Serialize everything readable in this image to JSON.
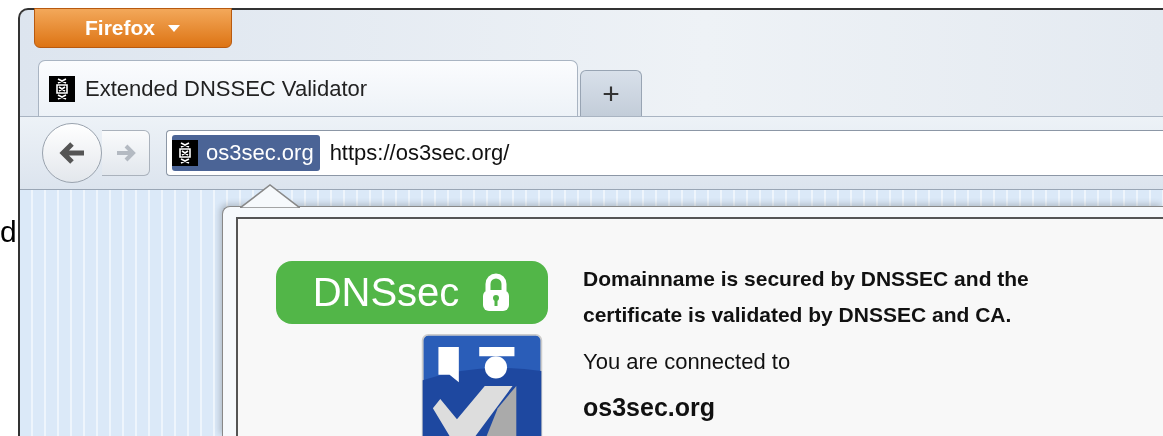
{
  "edge_text": "d",
  "menu_button": {
    "label": "Firefox"
  },
  "tabs": [
    {
      "title": "Extended DNSSEC Validator",
      "selected": true
    }
  ],
  "new_tab_button": {
    "label": "+"
  },
  "navigation": {
    "back": {
      "disabled": false
    },
    "forward": {
      "disabled": true
    }
  },
  "address_bar": {
    "identity_label": "os3sec.org",
    "url": "https://os3sec.org/"
  },
  "popup": {
    "badge": "DNSsec",
    "heading": "Domainname is secured by DNSSEC and the certificate is validated by DNSSEC and CA.",
    "connected_label": "You are connected to",
    "domain": "os3sec.org"
  }
}
